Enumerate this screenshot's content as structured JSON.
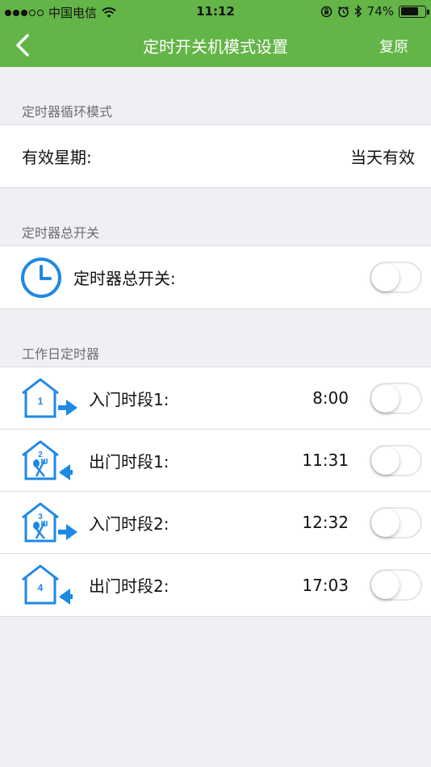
{
  "status_bar": {
    "carrier": "中国电信",
    "time": "11:12",
    "battery_percent_label": "74%",
    "battery_level": 0.74
  },
  "nav": {
    "title": "定时开关机模式设置",
    "right_button": "复原"
  },
  "cycle_section": {
    "header": "定时器循环模式",
    "label": "有效星期:",
    "value": "当天有效"
  },
  "master_section": {
    "header": "定时器总开关",
    "label": "定时器总开关:",
    "toggle_on": false
  },
  "workday_section": {
    "header": "工作日定时器",
    "rows": [
      {
        "label": "入门时段1:",
        "time": "8:00",
        "icon_number": "1",
        "icon_kind": "enter",
        "toggle_on": false
      },
      {
        "label": "出门时段1:",
        "time": "11:31",
        "icon_number": "2",
        "icon_kind": "meal-exit",
        "toggle_on": false
      },
      {
        "label": "入门时段2:",
        "time": "12:32",
        "icon_number": "3",
        "icon_kind": "meal-enter",
        "toggle_on": false
      },
      {
        "label": "出门时段2:",
        "time": "17:03",
        "icon_number": "4",
        "icon_kind": "exit",
        "toggle_on": false
      }
    ]
  },
  "colors": {
    "accent_green": "#63b547",
    "icon_blue": "#1e88e5",
    "background": "#efeff4"
  }
}
